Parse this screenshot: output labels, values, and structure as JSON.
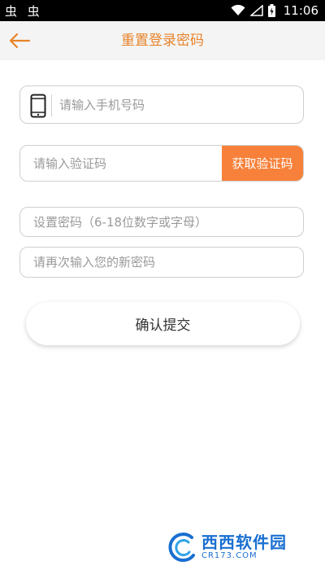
{
  "status_bar": {
    "left_icons": "虫 虫",
    "time": "11:06"
  },
  "header": {
    "title": "重置登录密码"
  },
  "form": {
    "phone_placeholder": "请输入手机号码",
    "code_placeholder": "请输入验证码",
    "get_code_label": "获取验证码",
    "password_placeholder": "设置密码（6-18位数字或字母）",
    "confirm_password_placeholder": "请再次输入您的新密码",
    "submit_label": "确认提交"
  },
  "watermark": {
    "main": "西西软件园",
    "sub": "CR173.COM"
  },
  "colors": {
    "accent": "#e8832a",
    "button_orange": "#f7813a"
  }
}
